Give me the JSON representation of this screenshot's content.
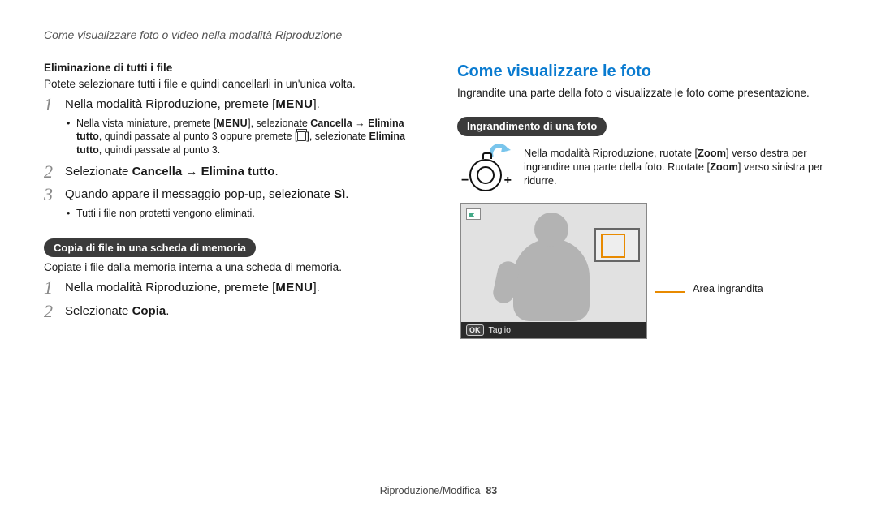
{
  "header": "Come visualizzare foto o video nella modalità Riproduzione",
  "left": {
    "s1_title": "Eliminazione di tutti i file",
    "s1_desc": "Potete selezionare tutti i file e quindi cancellarli in un'unica volta.",
    "step1_a": "Nella modalità Riproduzione, premete [",
    "menu": "MENU",
    "step1_b": "].",
    "step1_note_a": "Nella vista miniature, premete [",
    "step1_note_b": "], selezionate ",
    "step1_note_c": "Cancella → Elimina tutto",
    "step1_note_d": ", quindi passate al punto 3 oppure premete [",
    "step1_note_e": "], selezionate ",
    "step1_note_f": "Elimina tutto",
    "step1_note_g": ", quindi passate al punto 3.",
    "step2_a": "Selezionate ",
    "step2_b": "Cancella → Elimina tutto",
    "step2_c": ".",
    "step3_a": "Quando appare il messaggio pop-up, selezionate ",
    "step3_b": "Sì",
    "step3_c": ".",
    "step3_note": "Tutti i file non protetti vengono eliminati.",
    "s2_pill": "Copia di file in una scheda di memoria",
    "s2_desc": "Copiate i file dalla memoria interna a una scheda di memoria.",
    "s2_step1_a": "Nella modalità Riproduzione, premete [",
    "s2_step1_b": "].",
    "s2_step2_a": "Selezionate ",
    "s2_step2_b": "Copia",
    "s2_step2_c": "."
  },
  "right": {
    "h2": "Come visualizzare le foto",
    "subtitle": "Ingrandite una parte della foto o visualizzate le foto come presentazione.",
    "pill": "Ingrandimento di una foto",
    "zoom_a": "Nella modalità Riproduzione, ruotate [",
    "zoom_b": "Zoom",
    "zoom_c": "] verso destra per ingrandire una parte della foto. Ruotate [",
    "zoom_d": "Zoom",
    "zoom_e": "] verso sinistra per ridurre.",
    "ok": "OK",
    "taglio": "Taglio",
    "area_label": "Area ingrandita",
    "minus": "−",
    "plus": "+"
  },
  "footer": {
    "section": "Riproduzione/Modifica",
    "page": "83"
  },
  "numbers": {
    "n1": "1",
    "n2": "2",
    "n3": "3"
  }
}
